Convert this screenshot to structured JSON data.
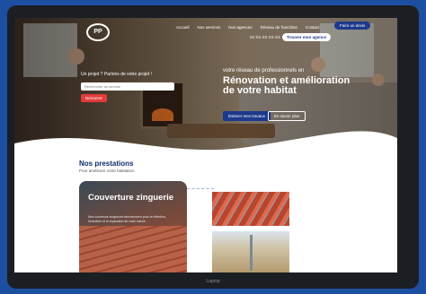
{
  "nav": {
    "logo_text": "PP",
    "items": [
      "Accueil",
      "Nos services",
      "Nos agences",
      "Réseau de franchise",
      "Contact"
    ],
    "cta_label": "Faire un devis",
    "phone": "04 XX XX XX XX",
    "devis_label": "Trouver mon agence"
  },
  "hero": {
    "search_label": "Un projet ? Parlons de votre projet !",
    "search_placeholder": "Rechercher un service",
    "start_label": "Démarrer",
    "kicker": "votre réseau de professionnels en",
    "title": "Rénovation et amélioration de votre habitat",
    "btn_estimate": "Estimer mes travaux",
    "btn_more": "En savoir plus"
  },
  "services": {
    "title": "Nos prestations",
    "subtitle": "Pour améliorer votre habitation",
    "card_title": "Couverture zinguerie",
    "card_text": "Nos couvreurs zingueurs interviennent pour la réfection, l'entretien et la réparation de votre toiture."
  },
  "footer": {
    "device_label": "Laptop"
  }
}
